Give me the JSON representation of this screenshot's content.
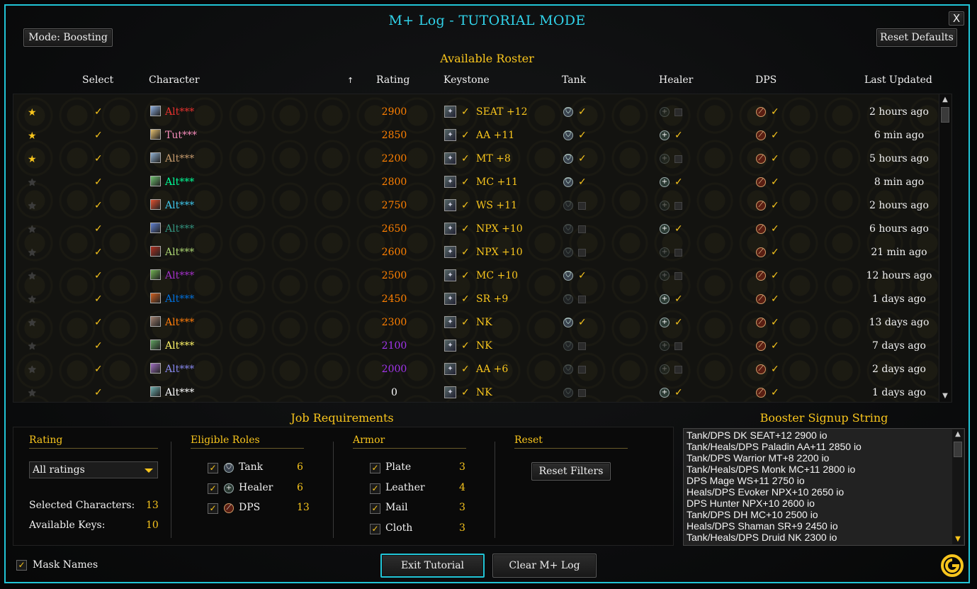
{
  "window": {
    "title": "M+ Log - TUTORIAL MODE",
    "close_label": "X"
  },
  "header": {
    "mode_button": "Mode: Boosting",
    "reset_defaults": "Reset Defaults"
  },
  "roster": {
    "title": "Available Roster",
    "columns": {
      "select": "Select",
      "character": "Character",
      "rating": "Rating",
      "keystone": "Keystone",
      "tank": "Tank",
      "healer": "Healer",
      "dps": "DPS",
      "updated": "Last Updated"
    },
    "sort_indicator": "↑",
    "rows": [
      {
        "fav": true,
        "selected": true,
        "name": "Alt***",
        "name_color": "#e8312e",
        "class_color": "#8fb0e0",
        "rating": "2900",
        "rating_color": "#ff8000",
        "keystone": "SEAT +12",
        "tank": true,
        "healer": false,
        "dps": true,
        "updated": "2 hours ago"
      },
      {
        "fav": true,
        "selected": true,
        "name": "Tut***",
        "name_color": "#f58cba",
        "class_color": "#e6c070",
        "rating": "2850",
        "rating_color": "#ff8000",
        "keystone": "AA +11",
        "tank": true,
        "healer": true,
        "dps": true,
        "updated": "6 min ago"
      },
      {
        "fav": true,
        "selected": true,
        "name": "Alt***",
        "name_color": "#c69b6d",
        "class_color": "#90b0d0",
        "rating": "2200",
        "rating_color": "#ff8000",
        "keystone": "MT +8",
        "tank": true,
        "healer": false,
        "dps": true,
        "updated": "5 hours ago"
      },
      {
        "fav": false,
        "selected": true,
        "name": "Alt***",
        "name_color": "#00ff98",
        "class_color": "#70c070",
        "rating": "2800",
        "rating_color": "#ff8000",
        "keystone": "MC +11",
        "tank": true,
        "healer": true,
        "dps": true,
        "updated": "8 min ago"
      },
      {
        "fav": false,
        "selected": true,
        "name": "Alt***",
        "name_color": "#3fc7eb",
        "class_color": "#e05030",
        "rating": "2750",
        "rating_color": "#ff8000",
        "keystone": "WS +11",
        "tank": false,
        "healer": false,
        "dps": true,
        "updated": "2 hours ago"
      },
      {
        "fav": false,
        "selected": true,
        "name": "Alt***",
        "name_color": "#33937f",
        "class_color": "#6080d0",
        "rating": "2650",
        "rating_color": "#ff8000",
        "keystone": "NPX +10",
        "tank": false,
        "healer": true,
        "dps": true,
        "updated": "6 hours ago"
      },
      {
        "fav": false,
        "selected": true,
        "name": "Alt***",
        "name_color": "#aad372",
        "class_color": "#b03020",
        "rating": "2600",
        "rating_color": "#ff8000",
        "keystone": "NPX +10",
        "tank": false,
        "healer": false,
        "dps": true,
        "updated": "21 min ago"
      },
      {
        "fav": false,
        "selected": true,
        "name": "Alt***",
        "name_color": "#a330c9",
        "class_color": "#70b050",
        "rating": "2500",
        "rating_color": "#ff8000",
        "keystone": "MC +10",
        "tank": true,
        "healer": false,
        "dps": true,
        "updated": "12 hours ago"
      },
      {
        "fav": false,
        "selected": true,
        "name": "Alt***",
        "name_color": "#0070dd",
        "class_color": "#d06020",
        "rating": "2450",
        "rating_color": "#ff8000",
        "keystone": "SR +9",
        "tank": false,
        "healer": true,
        "dps": true,
        "updated": "1 days ago"
      },
      {
        "fav": false,
        "selected": true,
        "name": "Alt***",
        "name_color": "#ff7c0a",
        "class_color": "#a08070",
        "rating": "2300",
        "rating_color": "#ff8000",
        "keystone": "NK",
        "tank": true,
        "healer": true,
        "dps": true,
        "updated": "13 days ago"
      },
      {
        "fav": false,
        "selected": true,
        "name": "Alt***",
        "name_color": "#fff468",
        "class_color": "#60a060",
        "rating": "2100",
        "rating_color": "#a335ee",
        "keystone": "NK",
        "tank": false,
        "healer": false,
        "dps": true,
        "updated": "7 days ago"
      },
      {
        "fav": false,
        "selected": true,
        "name": "Alt***",
        "name_color": "#8788ee",
        "class_color": "#a070c0",
        "rating": "2000",
        "rating_color": "#a335ee",
        "keystone": "AA +6",
        "tank": false,
        "healer": false,
        "dps": true,
        "updated": "2 days ago"
      },
      {
        "fav": false,
        "selected": true,
        "name": "Alt***",
        "name_color": "#ffffff",
        "class_color": "#70b0b0",
        "rating": "0",
        "rating_color": "#ffffff",
        "keystone": "NK",
        "tank": false,
        "healer": true,
        "dps": true,
        "updated": "1 days ago"
      }
    ]
  },
  "job_requirements": {
    "title": "Job Requirements",
    "rating": {
      "title": "Rating",
      "dropdown_value": "All ratings",
      "selected_label": "Selected Characters:",
      "selected_value": "13",
      "keys_label": "Available Keys:",
      "keys_value": "10"
    },
    "roles": {
      "title": "Eligible Roles",
      "items": [
        {
          "label": "Tank",
          "count": "6"
        },
        {
          "label": "Healer",
          "count": "6"
        },
        {
          "label": "DPS",
          "count": "13"
        }
      ]
    },
    "armor": {
      "title": "Armor",
      "items": [
        {
          "label": "Plate",
          "count": "3"
        },
        {
          "label": "Leather",
          "count": "4"
        },
        {
          "label": "Mail",
          "count": "3"
        },
        {
          "label": "Cloth",
          "count": "3"
        }
      ]
    },
    "reset": {
      "title": "Reset",
      "button": "Reset Filters"
    }
  },
  "booster": {
    "title": "Booster Signup String",
    "lines": [
      "Tank/DPS DK SEAT+12 2900 io",
      "Tank/Heals/DPS Paladin AA+11 2850 io",
      "Tank/DPS Warrior MT+8 2200 io",
      "Tank/Heals/DPS Monk MC+11 2800 io",
      "DPS Mage WS+11 2750 io",
      "Heals/DPS Evoker NPX+10 2650 io",
      "DPS Hunter NPX+10 2600 io",
      "Tank/DPS DH MC+10 2500 io",
      "Heals/DPS Shaman SR+9 2450 io",
      "Tank/Heals/DPS Druid NK 2300 io"
    ]
  },
  "footer": {
    "mask_names": "Mask Names",
    "exit_tutorial": "Exit Tutorial",
    "clear_log": "Clear M+ Log"
  },
  "colors": {
    "accent": "#21c4d6",
    "gold": "#f8c51d"
  },
  "icons": {
    "star": "star-icon",
    "check": "check-icon",
    "tank": "shield-icon",
    "healer": "plus-icon",
    "dps": "sword-icon",
    "keystone": "keystone-icon",
    "logo": "addon-logo-icon"
  }
}
